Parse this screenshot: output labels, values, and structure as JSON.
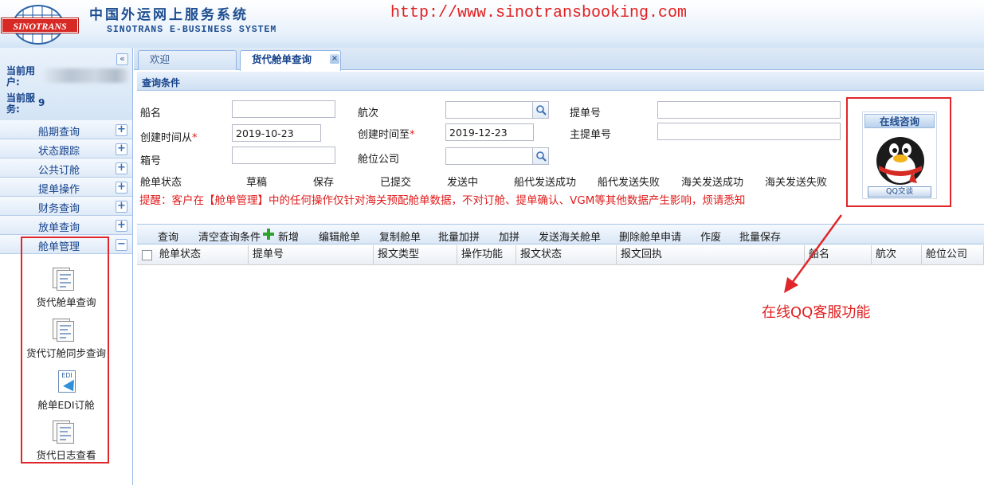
{
  "header": {
    "logo_text": "SINOTRANS",
    "title_cn": "中国外运网上服务系统",
    "title_en": "SINOTRANS E-BUSINESS SYSTEM",
    "url": "http://www.sinotransbooking.com"
  },
  "sidebar": {
    "collapse_icon": "double-chevron-left-icon",
    "user_label": "当前用户:",
    "service_label": "当前服务:",
    "service_value": "9",
    "nav": [
      {
        "label": "船期查询",
        "toggle": "+"
      },
      {
        "label": "状态跟踪",
        "toggle": "+"
      },
      {
        "label": "公共订舱",
        "toggle": "+"
      },
      {
        "label": "提单操作",
        "toggle": "+"
      },
      {
        "label": "财务查询",
        "toggle": "+"
      },
      {
        "label": "放单查询",
        "toggle": "+"
      },
      {
        "label": "舱单管理",
        "toggle": "−"
      }
    ],
    "modules": [
      {
        "label": "货代舱单查询",
        "icon": "document-icon"
      },
      {
        "label": "货代订舱同步查询",
        "icon": "document-icon"
      },
      {
        "label": "舱单EDI订舱",
        "icon": "edi-icon"
      },
      {
        "label": "货代日志查看",
        "icon": "document-icon"
      }
    ]
  },
  "tabs": [
    {
      "label": "欢迎"
    },
    {
      "label": "货代舱单查询"
    }
  ],
  "criteria": {
    "title": "查询条件",
    "fields": {
      "ship_name": {
        "label": "船名",
        "value": ""
      },
      "voyage": {
        "label": "航次",
        "value": ""
      },
      "bill_no": {
        "label": "提单号",
        "value": ""
      },
      "created_from": {
        "label": "创建时间从",
        "required": "*",
        "value": "2019-10-23"
      },
      "created_to": {
        "label": "创建时间至",
        "required": "*",
        "value": "2019-12-23"
      },
      "master_bill_no": {
        "label": "主提单号",
        "value": ""
      },
      "container_no": {
        "label": "箱号",
        "value": ""
      },
      "space_company": {
        "label": "舱位公司",
        "value": ""
      }
    },
    "status": {
      "label": "舱单状态",
      "options": [
        "草稿",
        "保存",
        "已提交",
        "发送中",
        "船代发送成功",
        "船代发送失败",
        "海关发送成功",
        "海关发送失败"
      ]
    },
    "reminder": "提醒：客户在【舱单管理】中的任何操作仅针对海关预配舱单数据，不对订舱、提单确认、VGM等其他数据产生影响，烦请悉知"
  },
  "qq": {
    "title": "在线咨询",
    "button": "QQ交谈",
    "avatar_icon": "qq-penguin-icon"
  },
  "toolbar": {
    "query": "查询",
    "clear": "清空查询条件",
    "add": "新增",
    "edit": "编辑舱单",
    "copy": "复制舱单",
    "batch_add": "批量加拼",
    "consolidate": "加拼",
    "send_customs": "发送海关舱单",
    "delete_request": "删除舱单申请",
    "void": "作废",
    "batch_save": "批量保存"
  },
  "grid": {
    "columns": [
      "舱单状态",
      "提单号",
      "报文类型",
      "操作功能",
      "报文状态",
      "报文回执",
      "船名",
      "航次",
      "舱位公司"
    ]
  },
  "annotation": {
    "text": "在线QQ客服功能",
    "color": "#e02020"
  },
  "colors": {
    "accent": "#15428b",
    "border": "#99bbe8",
    "alert_red": "#e01b1b",
    "logo_red": "#d72a25"
  }
}
